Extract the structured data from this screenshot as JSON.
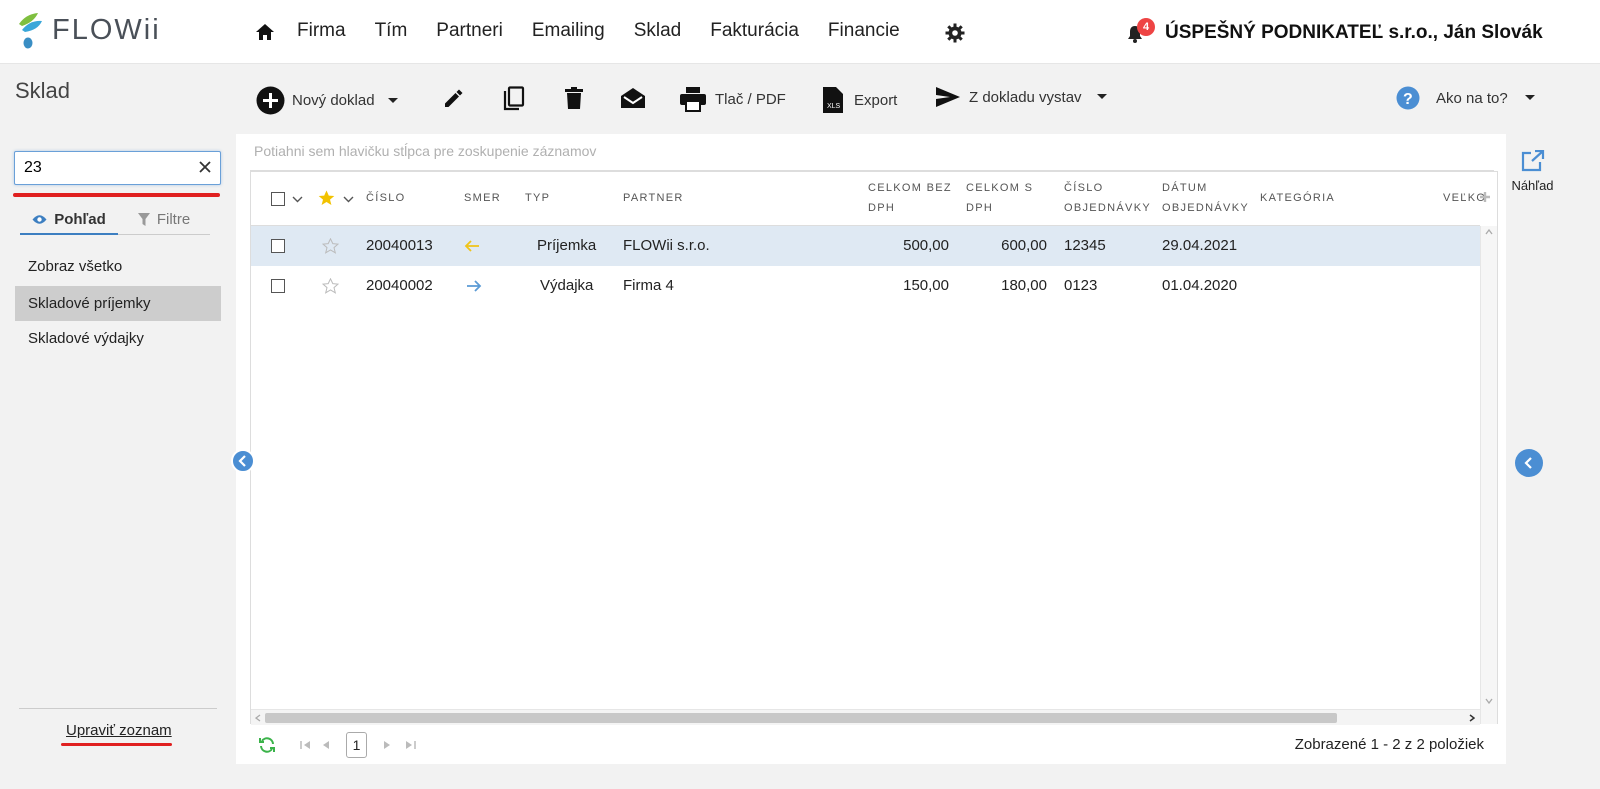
{
  "header": {
    "logo_text": "FLOWii",
    "nav": [
      "Firma",
      "Tím",
      "Partneri",
      "Emailing",
      "Sklad",
      "Fakturácia",
      "Financie"
    ],
    "notification_count": "4",
    "company_user": "ÚSPEŠNÝ PODNIKATEĽ s.r.o., Ján Slovák"
  },
  "page": {
    "title": "Sklad"
  },
  "toolbar": {
    "new_doc": "Nový doklad",
    "print": "Tlač / PDF",
    "export": "Export",
    "from_doc": "Z dokladu vystav",
    "help": "Ako na to?",
    "export_icon_text": "XLS"
  },
  "sidebar": {
    "search_value": "23",
    "tab_view": "Pohľad",
    "tab_filter": "Filtre",
    "views": [
      "Zobraz všetko",
      "Skladové príjemky",
      "Skladové výdajky"
    ],
    "edit_list": "Upraviť zoznam"
  },
  "grid": {
    "group_hint": "Potiahni sem hlavičku stĺpca pre zoskupenie záznamov",
    "columns": {
      "number": "ČÍSLO",
      "direction": "SMER",
      "type": "TYP",
      "partner": "PARTNER",
      "total_no_vat_1": "CELKOM BEZ",
      "total_no_vat_2": "DPH",
      "total_vat_1": "CELKOM S",
      "total_vat_2": "DPH",
      "order_no_1": "ČÍSLO",
      "order_no_2": "OBJEDNÁVKY",
      "order_date_1": "DÁTUM",
      "order_date_2": "OBJEDNÁVKY",
      "category": "KATEGÓRIA",
      "size": "VEĽKO"
    },
    "rows": [
      {
        "number": "20040013",
        "direction": "in",
        "type": "Príjemka",
        "partner": "FLOWii s.r.o.",
        "total_no_vat": "500,00",
        "total_vat": "600,00",
        "order_no": "12345",
        "order_date": "29.04.2021"
      },
      {
        "number": "20040002",
        "direction": "out",
        "type": "Výdajka",
        "partner": "Firma 4",
        "total_no_vat": "150,00",
        "total_vat": "180,00",
        "order_no": "0123",
        "order_date": "01.04.2020"
      }
    ]
  },
  "pager": {
    "page": "1",
    "summary": "Zobrazené 1 - 2 z 2 položiek"
  },
  "right_panel": {
    "preview": "Náhľad"
  },
  "colors": {
    "accent_blue": "#4b8ed3",
    "selected_row": "#dfe9f3",
    "arrow_in": "#f0c419",
    "arrow_out": "#5b9bd5",
    "red_highlight": "#e02020",
    "badge": "#e44444"
  }
}
